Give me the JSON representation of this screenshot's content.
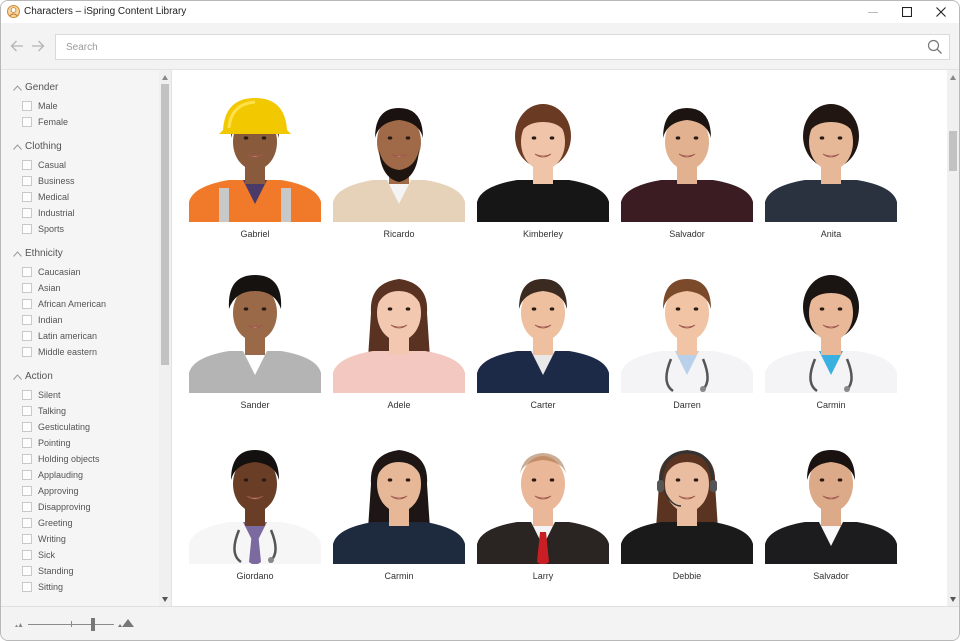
{
  "window": {
    "title": "Characters – iSpring Content Library",
    "minimize_label": "Minimize",
    "maximize_label": "Maximize",
    "close_label": "Close"
  },
  "toolbar": {
    "back_label": "Back",
    "forward_label": "Forward",
    "search": {
      "placeholder": "Search",
      "value": ""
    }
  },
  "filters": [
    {
      "group": "Gender",
      "expanded": true,
      "items": [
        "Male",
        "Female"
      ]
    },
    {
      "group": "Clothing",
      "expanded": true,
      "items": [
        "Casual",
        "Business",
        "Medical",
        "Industrial",
        "Sports"
      ]
    },
    {
      "group": "Ethnicity",
      "expanded": true,
      "items": [
        "Caucasian",
        "Asian",
        "African American",
        "Indian",
        "Latin american",
        "Middle eastern"
      ]
    },
    {
      "group": "Action",
      "expanded": true,
      "items": [
        "Silent",
        "Talking",
        "Gesticulating",
        "Pointing",
        "Holding objects",
        "Applauding",
        "Approving",
        "Disapproving",
        "Greeting",
        "Writing",
        "Sick",
        "Standing",
        "Sitting"
      ]
    }
  ],
  "characters": [
    {
      "name": "Gabriel",
      "skin": "#8a5a3c",
      "hair": "#2a1a12",
      "shirt": "#f07a2a",
      "inner": "#4a3a6a",
      "accessory": "hardhat",
      "hair_style": "short"
    },
    {
      "name": "Ricardo",
      "skin": "#a06a48",
      "hair": "#1a1210",
      "shirt": "#e6d2b8",
      "inner": "#f4f4f4",
      "accessory": "beard",
      "hair_style": "short"
    },
    {
      "name": "Kimberley",
      "skin": "#efc4a8",
      "hair": "#6a3a22",
      "shirt": "#161616",
      "inner": "#161616",
      "accessory": "none",
      "hair_style": "bun"
    },
    {
      "name": "Salvador",
      "skin": "#e2b290",
      "hair": "#1c1410",
      "shirt": "#3a1c22",
      "inner": "#3a1c22",
      "accessory": "none",
      "hair_style": "short"
    },
    {
      "name": "Anita",
      "skin": "#e6b898",
      "hair": "#221612",
      "shirt": "#2a3240",
      "inner": "#2a3240",
      "accessory": "none",
      "hair_style": "bun"
    },
    {
      "name": "Sander",
      "skin": "#9a6a48",
      "hair": "#161210",
      "shirt": "#b4b4b4",
      "inner": "#ffffff",
      "accessory": "none",
      "hair_style": "tall"
    },
    {
      "name": "Adele",
      "skin": "#f2c8b0",
      "hair": "#5a3222",
      "shirt": "#f2c8c0",
      "inner": "#f2c8c0",
      "accessory": "none",
      "hair_style": "long"
    },
    {
      "name": "Carter",
      "skin": "#eec0a0",
      "hair": "#3a2a20",
      "shirt": "#1c2a48",
      "inner": "#e8e8e8",
      "accessory": "none",
      "hair_style": "short"
    },
    {
      "name": "Darren",
      "skin": "#f0c4a4",
      "hair": "#7a4a2a",
      "shirt": "#f4f4f6",
      "inner": "#b8d0ea",
      "accessory": "stethoscope",
      "hair_style": "short"
    },
    {
      "name": "Carmin",
      "skin": "#e8b898",
      "hair": "#1a1412",
      "shirt": "#f4f4f6",
      "inner": "#3ab0e0",
      "accessory": "stethoscope",
      "hair_style": "bun"
    },
    {
      "name": "Giordano",
      "skin": "#6a3e26",
      "hair": "#141010",
      "shirt": "#f6f6f6",
      "inner": "#7a6aa0",
      "accessory": "stethoscope",
      "hair_style": "short"
    },
    {
      "name": "Carmin",
      "skin": "#e6b898",
      "hair": "#1e1614",
      "shirt": "#1e2a3e",
      "inner": "#1e2a3e",
      "accessory": "none",
      "hair_style": "long"
    },
    {
      "name": "Larry",
      "skin": "#eab898",
      "hair": "#a06a40",
      "shirt": "#2a2422",
      "inner": "#f4f4f4",
      "accessory": "redtie",
      "hair_style": "bald"
    },
    {
      "name": "Debbie",
      "skin": "#eabca0",
      "hair": "#5a3420",
      "shirt": "#1a1a1a",
      "inner": "#1a1a1a",
      "accessory": "headset",
      "hair_style": "long"
    },
    {
      "name": "Salvador",
      "skin": "#dcaa88",
      "hair": "#1a1210",
      "shirt": "#1c1c1e",
      "inner": "#f8f8f8",
      "accessory": "none",
      "hair_style": "short"
    }
  ],
  "footer": {
    "thumbnail_size_percent": 75,
    "zoom_out_label": "Smaller thumbnails",
    "zoom_in_label": "Larger thumbnails"
  }
}
